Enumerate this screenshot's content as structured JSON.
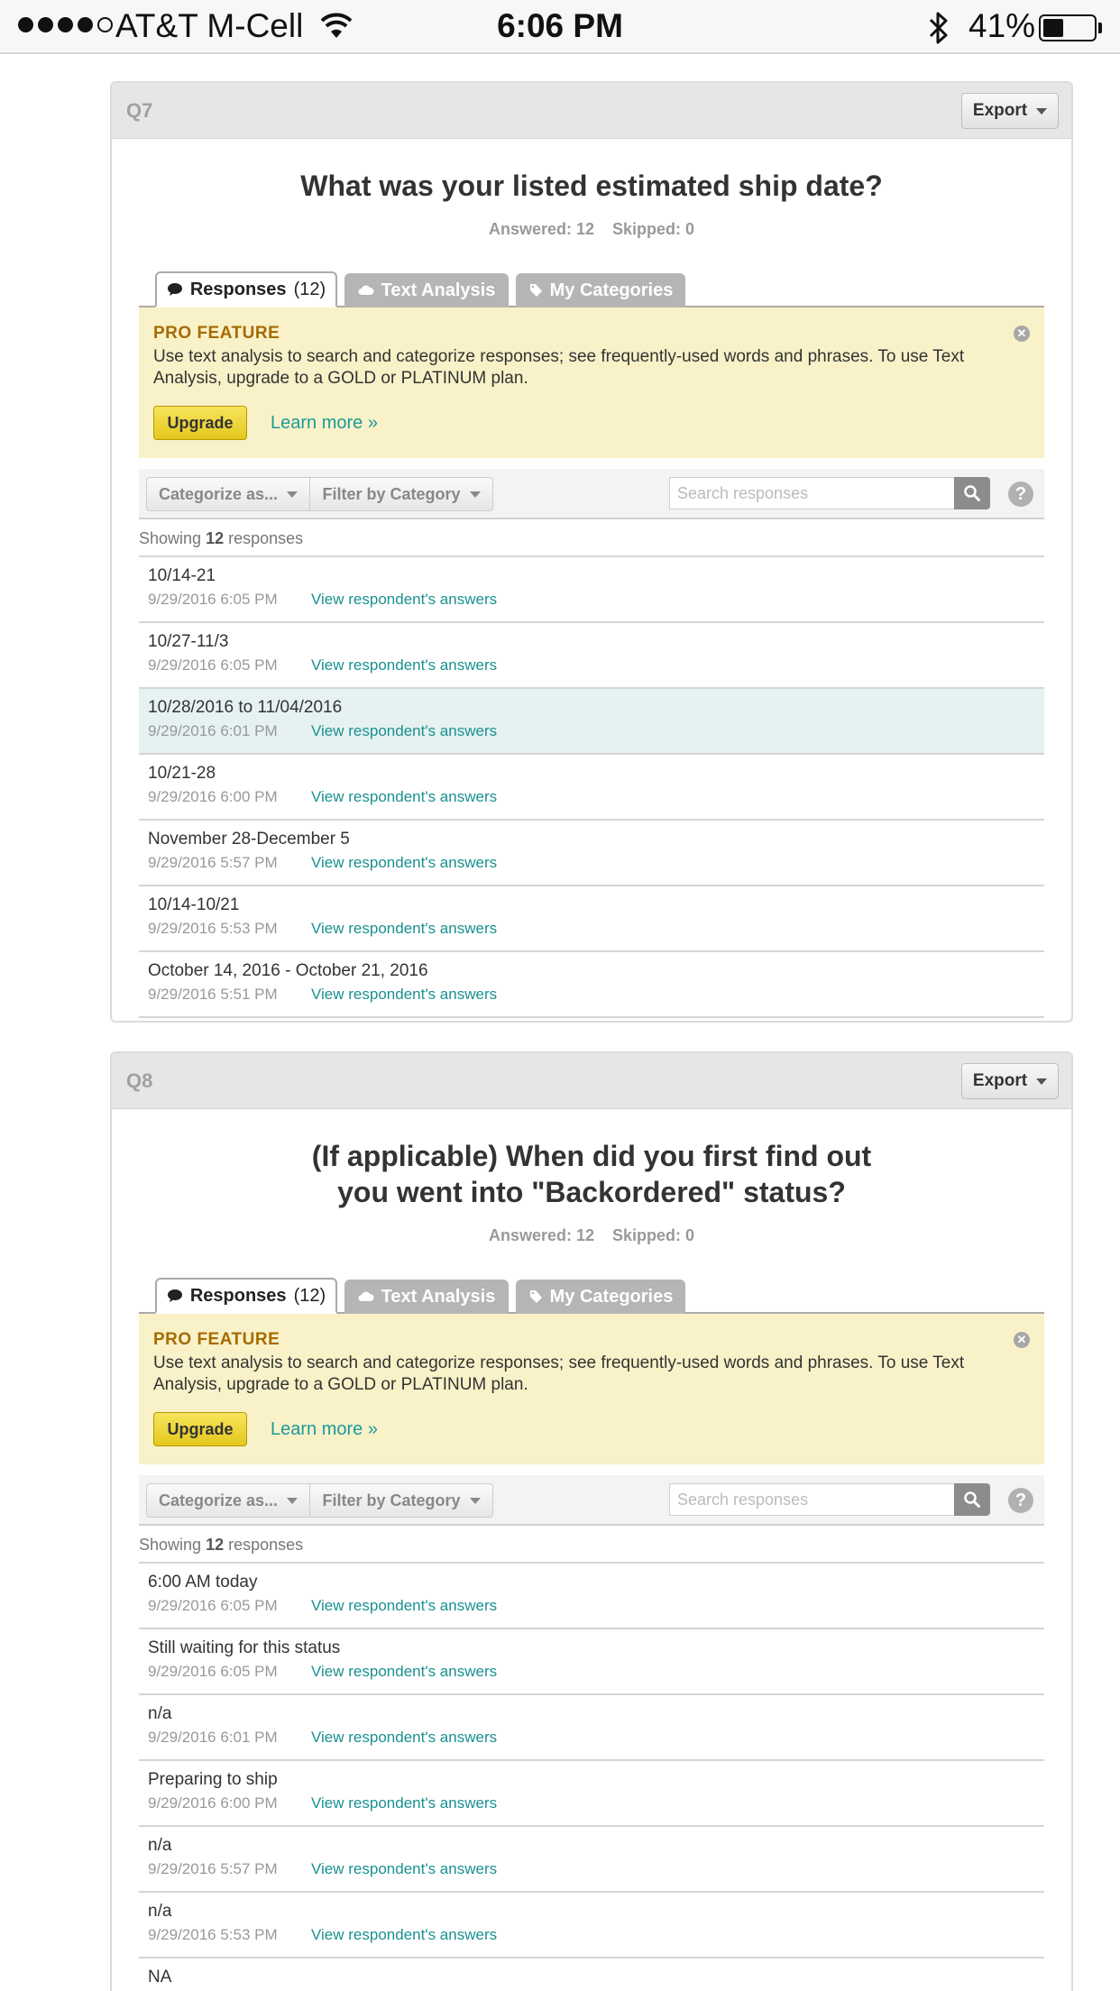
{
  "status_bar": {
    "carrier": "AT&T M-Cell",
    "time": "6:06 PM",
    "battery": "41%",
    "battery_level": 0.41,
    "signal_bars": 4,
    "signal_max": 5
  },
  "colors": {
    "link": "#1a9090",
    "pro_background": "#f9f1c8",
    "pro_title": "#a56b00",
    "upgrade_button": "#e3c81c",
    "highlight_row": "#e5f2f1"
  },
  "questions": [
    {
      "number": "Q7",
      "export_label": "Export",
      "title_lines": [
        "What was your listed estimated ship date?"
      ],
      "answered": "Answered: 12",
      "skipped": "Skipped: 0",
      "tabs": {
        "responses": "Responses",
        "responses_count": "(12)",
        "text_analysis": "Text Analysis",
        "my_categories": "My Categories"
      },
      "pro": {
        "title": "PRO FEATURE",
        "text": "Use text analysis to search and categorize responses; see frequently-used words and phrases. To use Text Analysis, upgrade to a GOLD or PLATINUM plan.",
        "upgrade": "Upgrade",
        "learn_more": "Learn more »"
      },
      "toolbar": {
        "categorize": "Categorize as...",
        "filter": "Filter by Category",
        "search_placeholder": "Search responses"
      },
      "showing_prefix": "Showing",
      "showing_count": "12",
      "showing_suffix": "responses",
      "link_label": "View respondent's answers",
      "responses": [
        {
          "text": "10/14-21",
          "date": "9/29/2016 6:05 PM"
        },
        {
          "text": "10/27-11/3",
          "date": "9/29/2016 6:05 PM"
        },
        {
          "text": "10/28/2016 to 11/04/2016",
          "date": "9/29/2016 6:01 PM",
          "highlight": true
        },
        {
          "text": "10/21-28",
          "date": "9/29/2016 6:00 PM"
        },
        {
          "text": "November 28-December 5",
          "date": "9/29/2016 5:57 PM"
        },
        {
          "text": "10/14-10/21",
          "date": "9/29/2016 5:53 PM"
        },
        {
          "text": "October 14, 2016 - October 21, 2016",
          "date": "9/29/2016 5:51 PM"
        }
      ]
    },
    {
      "number": "Q8",
      "export_label": "Export",
      "title_lines": [
        "(If applicable) When did you first find out",
        "you went into \"Backordered\" status?"
      ],
      "answered": "Answered: 12",
      "skipped": "Skipped: 0",
      "tabs": {
        "responses": "Responses",
        "responses_count": "(12)",
        "text_analysis": "Text Analysis",
        "my_categories": "My Categories"
      },
      "pro": {
        "title": "PRO FEATURE",
        "text": "Use text analysis to search and categorize responses; see frequently-used words and phrases. To use Text Analysis, upgrade to a GOLD or PLATINUM plan.",
        "upgrade": "Upgrade",
        "learn_more": "Learn more »"
      },
      "toolbar": {
        "categorize": "Categorize as...",
        "filter": "Filter by Category",
        "search_placeholder": "Search responses"
      },
      "showing_prefix": "Showing",
      "showing_count": "12",
      "showing_suffix": "responses",
      "link_label": "View respondent's answers",
      "responses": [
        {
          "text": "6:00 AM today",
          "date": "9/29/2016 6:05 PM"
        },
        {
          "text": "Still waiting for this status",
          "date": "9/29/2016 6:05 PM"
        },
        {
          "text": "n/a",
          "date": "9/29/2016 6:01 PM"
        },
        {
          "text": "Preparing to ship",
          "date": "9/29/2016 6:00 PM"
        },
        {
          "text": "n/a",
          "date": "9/29/2016 5:57 PM"
        },
        {
          "text": "n/a",
          "date": "9/29/2016 5:53 PM"
        },
        {
          "text": "NA",
          "date": ""
        }
      ]
    }
  ]
}
